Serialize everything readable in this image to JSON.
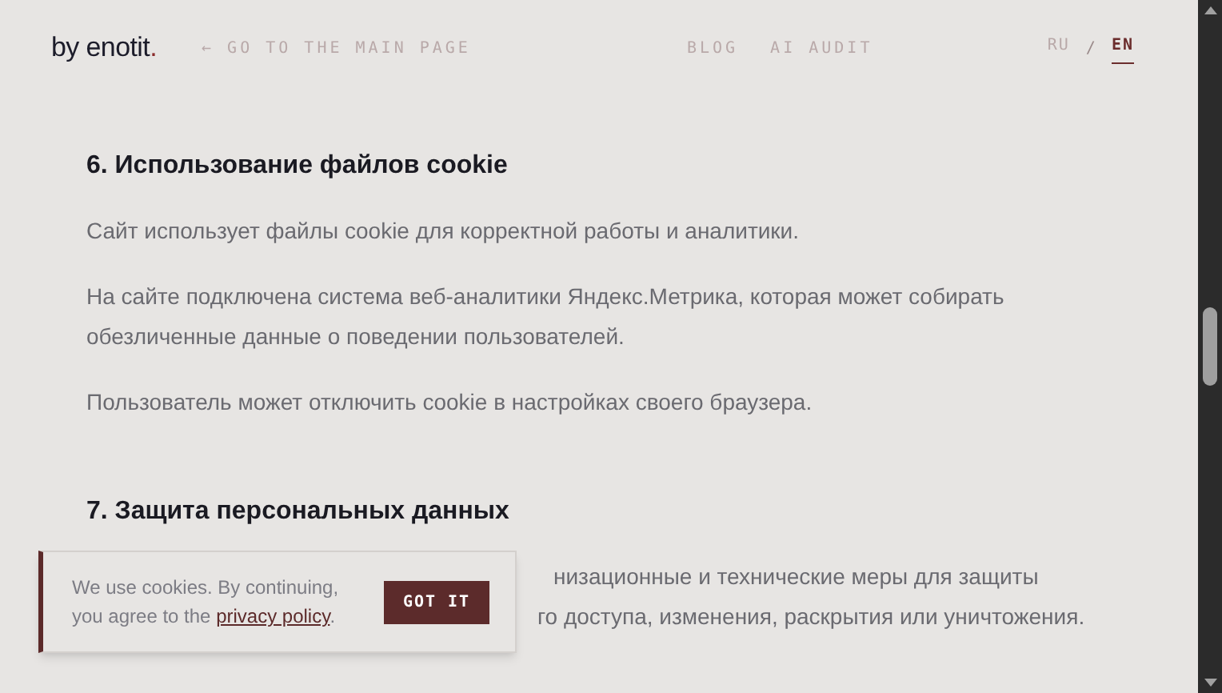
{
  "header": {
    "logo": "by enotit",
    "logo_dot": ".",
    "back_link": "← GO TO THE MAIN PAGE",
    "nav": [
      {
        "label": "BLOG"
      },
      {
        "label": "AI AUDIT"
      }
    ],
    "languages": [
      {
        "label": "RU",
        "selected": false
      },
      {
        "label": "EN",
        "selected": true
      }
    ],
    "lang_separator": "/"
  },
  "sections": [
    {
      "heading": "6. Использование файлов cookie",
      "paragraphs": [
        "Сайт использует файлы cookie для корректной работы и аналитики.",
        "На сайте подключена система веб-аналитики Яндекс.Метрика, которая может собирать обезличенные данные о поведении пользователей.",
        "Пользователь может отключить cookie в настройках своего браузера."
      ]
    },
    {
      "heading": "7. Защита персональных данных",
      "partial_lines": [
        "низационные и технические меры для защиты",
        "го доступа, изменения, раскрытия или уничтожения."
      ]
    }
  ],
  "cookie_banner": {
    "text_before": "We use cookies. By continuing, you agree to the ",
    "link": "privacy policy",
    "text_after": ".",
    "button": "GOT IT"
  }
}
